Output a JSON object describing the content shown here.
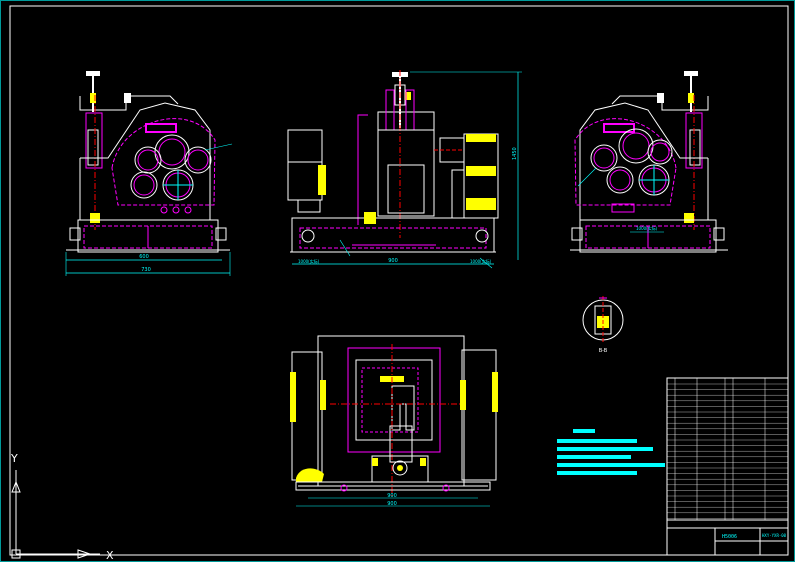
{
  "drawing": {
    "background": "#000000",
    "line_colors": {
      "frame": "#ffffff",
      "outline": "#ffffff",
      "hidden": "#ff00ff",
      "dimension": "#00ffff",
      "parts": "#ffff00",
      "center": "#ff0000",
      "note": "#00ffff"
    }
  },
  "dimensions": {
    "front_width": "730",
    "front_base": "600",
    "side_width": "900",
    "side_left": "1000(实际)",
    "side_right": "1000(实际)",
    "side_height": "1450",
    "rear_dim": "1000(实际)",
    "plan_width_1": "900",
    "plan_width_2": "900"
  },
  "detail_label": "B-B",
  "ucs": {
    "y_label": "Y",
    "x_label": "X"
  },
  "title_block": {
    "drawing_name": "H5006",
    "code": "HXY-YXR-00"
  }
}
